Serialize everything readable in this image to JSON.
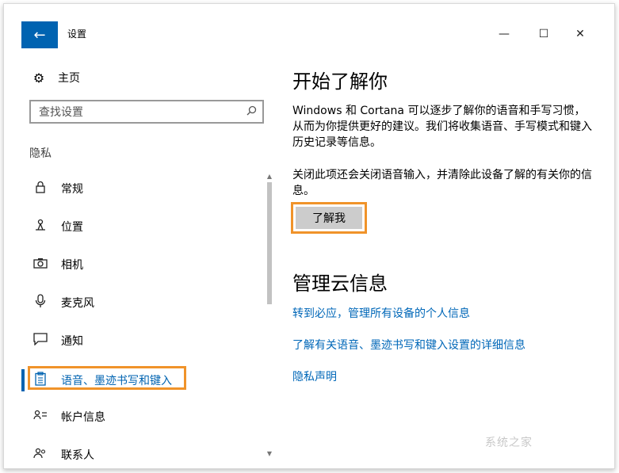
{
  "window": {
    "title": "设置",
    "back_icon": "←",
    "minimize_icon": "—",
    "maximize_icon": "☐",
    "close_icon": "✕"
  },
  "sidebar": {
    "home_label": "主页",
    "search_placeholder": "查找设置",
    "section_label": "隐私",
    "items": [
      {
        "label": "常规",
        "icon": "lock-icon"
      },
      {
        "label": "位置",
        "icon": "location-icon"
      },
      {
        "label": "相机",
        "icon": "camera-icon"
      },
      {
        "label": "麦克风",
        "icon": "microphone-icon"
      },
      {
        "label": "通知",
        "icon": "notification-icon"
      },
      {
        "label": "语音、墨迹书写和键入",
        "icon": "clipboard-icon",
        "active": true
      },
      {
        "label": "帐户信息",
        "icon": "account-icon"
      },
      {
        "label": "联系人",
        "icon": "contacts-icon"
      }
    ]
  },
  "main": {
    "heading1": "开始了解你",
    "para1": "Windows 和 Cortana 可以逐步了解你的语音和手写习惯，从而为你提供更好的建议。我们将收集语音、手写模式和键入历史记录等信息。",
    "para2": "关闭此项还会关闭语音输入，并清除此设备了解的有关你的信息。",
    "learn_button": "了解我",
    "heading2": "管理云信息",
    "links": [
      "转到必应，管理所有设备的个人信息",
      "了解有关语音、墨迹书写和键入设置的详细信息",
      "隐私声明"
    ]
  },
  "watermark": "系统之家",
  "colors": {
    "accent": "#0063b1",
    "link": "#0067b8",
    "highlight": "#f0932a"
  }
}
